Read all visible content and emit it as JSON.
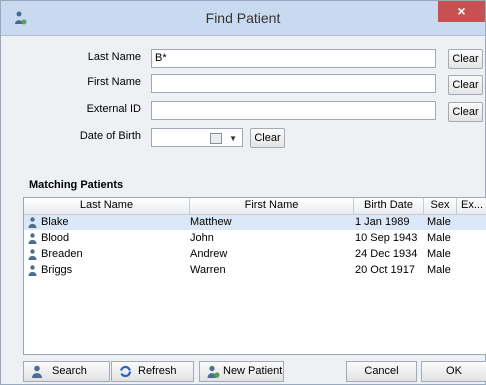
{
  "window": {
    "title": "Find Patient",
    "close_label": "×"
  },
  "form": {
    "last_name": {
      "label": "Last Name",
      "value": "B*",
      "clear": "Clear"
    },
    "first_name": {
      "label": "First Name",
      "value": "",
      "clear": "Clear"
    },
    "external_id": {
      "label": "External ID",
      "value": "",
      "clear": "Clear"
    },
    "dob": {
      "label": "Date of Birth",
      "value": "",
      "clear": "Clear"
    }
  },
  "results": {
    "section_title": "Matching Patients",
    "columns": [
      "Last Name",
      "First Name",
      "Birth Date",
      "Sex",
      "Ex..."
    ],
    "rows": [
      {
        "last": "Blake",
        "first": "Matthew",
        "birth": "1 Jan 1989",
        "sex": "Male"
      },
      {
        "last": "Blood",
        "first": "John",
        "birth": "10 Sep 1943",
        "sex": "Male"
      },
      {
        "last": "Breaden",
        "first": "Andrew",
        "birth": "24 Dec 1934",
        "sex": "Male"
      },
      {
        "last": "Briggs",
        "first": "Warren",
        "birth": "20 Oct 1917",
        "sex": "Male"
      }
    ]
  },
  "buttons": {
    "search": "Search",
    "refresh": "Refresh",
    "new_patient": "New Patient",
    "cancel": "Cancel",
    "ok": "OK"
  },
  "colors": {
    "selection": "#dbe8f7",
    "close": "#c75050",
    "titlebar": "#c9d9f0"
  }
}
